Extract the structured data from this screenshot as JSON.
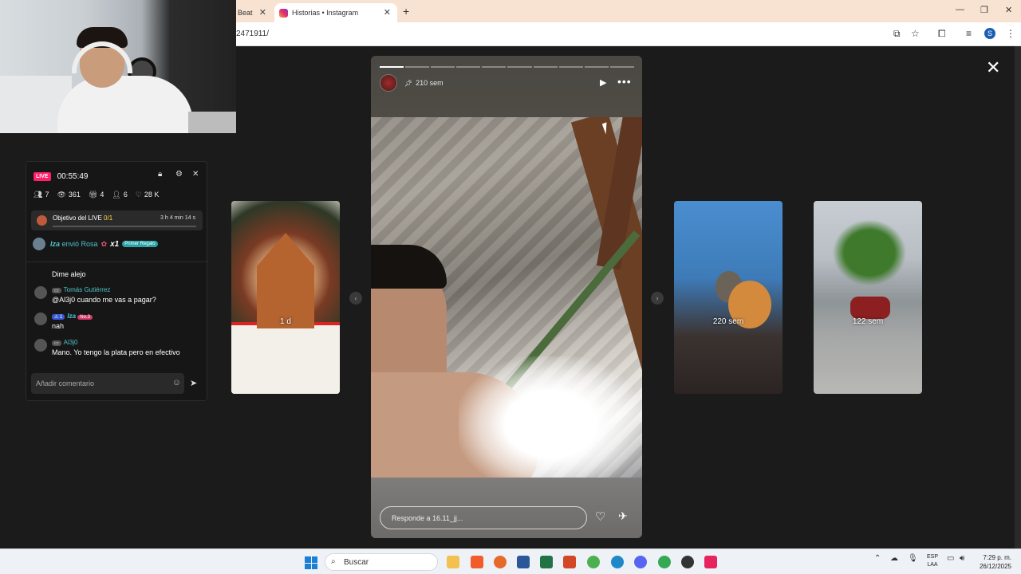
{
  "browser": {
    "tabs": [
      {
        "label": "Beat",
        "active": false
      },
      {
        "label": "Historias • Instagram",
        "active": true
      }
    ],
    "url": "2471911/",
    "profile_initial": "S"
  },
  "live_panel": {
    "badge": "LIVE",
    "elapsed": "00:55:49",
    "stats": [
      {
        "icon": "people-icon",
        "value": "7"
      },
      {
        "icon": "eye-icon",
        "value": "361"
      },
      {
        "icon": "gift-icon",
        "value": "4"
      },
      {
        "icon": "user-add-icon",
        "value": "6"
      },
      {
        "icon": "heart-icon",
        "value": "28 K"
      }
    ],
    "goal": {
      "label": "Objetivo del LIVE",
      "progress": "0/1",
      "time_left": "3 h 4 min 14 s"
    },
    "gift_banner": {
      "user": "Iza",
      "action": "envió Rosa",
      "count": "x1",
      "badge": "Primer Regalo"
    },
    "messages": [
      {
        "user": "",
        "text": "Dime alejo"
      },
      {
        "user": "Tomás Gutiérrez",
        "text": "@Al3j0 cuando me vas a pagar?"
      },
      {
        "user": "Iza",
        "level": "1",
        "rank": "No.3",
        "text": "nah"
      },
      {
        "user": "Al3j0",
        "text": "Mano. Yo tengo la plata pero en efectivo"
      }
    ],
    "comment_placeholder": "Añadir comentario"
  },
  "stories": {
    "left_thumb_label": "1 d",
    "right_thumb_1_label": "220 sem",
    "right_thumb_2_label": "122 sem",
    "current": {
      "time": "210 sem",
      "segments_total": 10,
      "segments_done": 1,
      "reply_placeholder": "Responde a 16.11_jj..."
    }
  },
  "taskbar": {
    "search_placeholder": "Buscar",
    "lang_line1": "ESP",
    "lang_line2": "LAA",
    "time": "7:29 p. m.",
    "date": "26/12/2025"
  },
  "colors": {
    "live_pink": "#ff1f6a",
    "teal_user": "#4fc3c8",
    "chrome_tabbar": "#f8e3d3"
  }
}
